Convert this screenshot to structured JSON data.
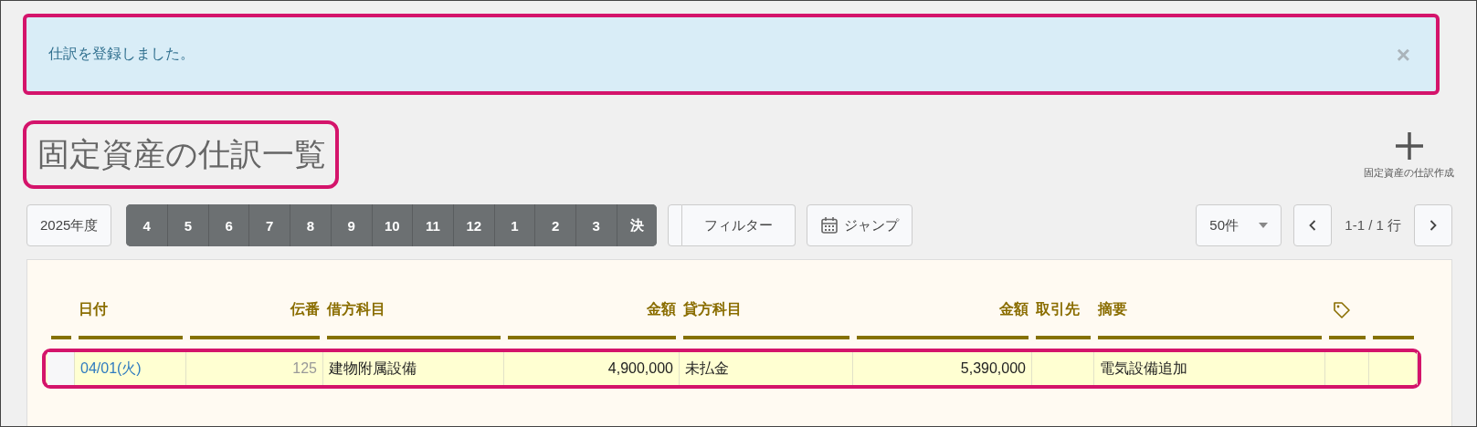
{
  "alert": {
    "message": "仕訳を登録しました。",
    "close": "×",
    "highlighted": true
  },
  "heading": {
    "text": "固定資産の仕訳一覧",
    "highlighted": true
  },
  "create_action": {
    "label": "固定資産の仕訳作成"
  },
  "toolbar": {
    "fiscal_year": "2025年度",
    "months": [
      "4",
      "5",
      "6",
      "7",
      "8",
      "9",
      "10",
      "11",
      "12",
      "1",
      "2",
      "3",
      "決"
    ],
    "filter": "フィルター",
    "jump": "ジャンプ",
    "per_page": "50件",
    "range": "1-1 / 1 行"
  },
  "table": {
    "columns": [
      "日付",
      "伝番",
      "借方科目",
      "金額",
      "貸方科目",
      "金額",
      "取引先",
      "摘要"
    ],
    "rows": [
      {
        "date": "04/01(火)",
        "number": "125",
        "debit_account": "建物附属設備",
        "debit_amount": "4,900,000",
        "credit_account": "未払金",
        "credit_amount": "5,390,000",
        "description": "電気設備追加",
        "highlighted": true
      }
    ]
  }
}
